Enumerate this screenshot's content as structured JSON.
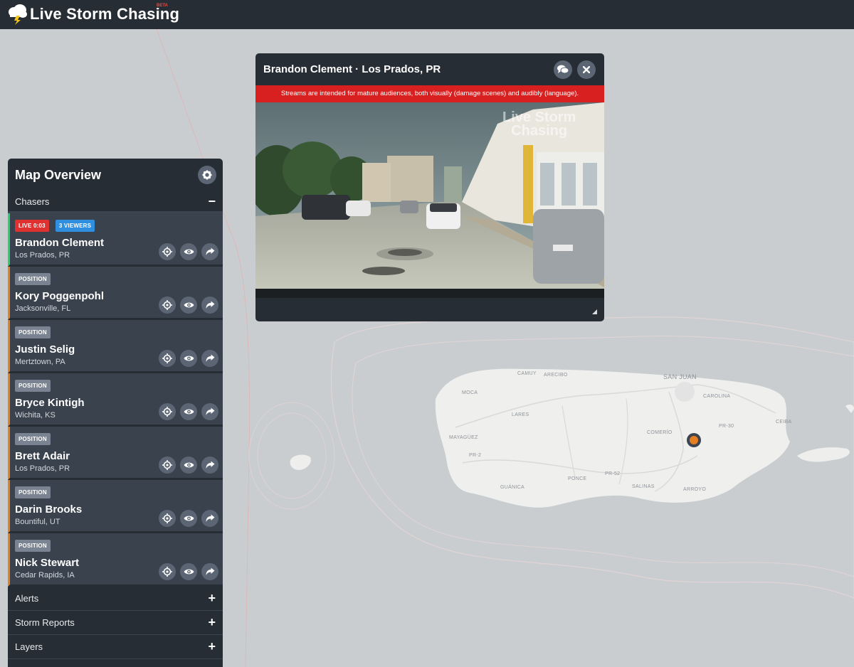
{
  "app": {
    "title": "Live Storm Chasing",
    "tag": "BETA"
  },
  "video": {
    "title": "Brandon Clement · Los Prados, PR",
    "warning": "Streams are intended for mature audiences, both visually (damage scenes) and audibly (language).",
    "watermark_line1": "Live Storm",
    "watermark_line2": "Chasing"
  },
  "panel": {
    "title": "Map Overview",
    "chasers_label": "Chasers",
    "chasers_toggle": "−",
    "chasers": [
      {
        "badge": "LIVE 0:03",
        "badge2": "3 VIEWERS",
        "name": "Brandon Clement",
        "location": "Los Prados, PR"
      },
      {
        "badge": "POSITION",
        "name": "Kory Poggenpohl",
        "location": "Jacksonville, FL"
      },
      {
        "badge": "POSITION",
        "name": "Justin Selig",
        "location": "Mertztown, PA"
      },
      {
        "badge": "POSITION",
        "name": "Bryce Kintigh",
        "location": "Wichita, KS"
      },
      {
        "badge": "POSITION",
        "name": "Brett Adair",
        "location": "Los Prados, PR"
      },
      {
        "badge": "POSITION",
        "name": "Darin Brooks",
        "location": "Bountiful, UT"
      },
      {
        "badge": "POSITION",
        "name": "Nick Stewart",
        "location": "Cedar Rapids, IA"
      }
    ],
    "sections": [
      {
        "label": "Alerts",
        "toggle": "+"
      },
      {
        "label": "Storm Reports",
        "toggle": "+"
      },
      {
        "label": "Layers",
        "toggle": "+"
      }
    ]
  },
  "map": {
    "labels": [
      "SAN JUAN",
      "CAMUY",
      "ARECIBO",
      "MOCA",
      "CAROLINA",
      "LARES",
      "PR-30",
      "COMERÍO",
      "CEIBA",
      "MAYAGÜEZ",
      "PR-2",
      "PR-52",
      "PONCE",
      "GUÁNICA",
      "SALINAS",
      "ARROYO"
    ]
  },
  "colors": {
    "live": "#2ecc71",
    "position": "#e67e22",
    "warning": "#d92020",
    "marker": "#e67e22"
  }
}
